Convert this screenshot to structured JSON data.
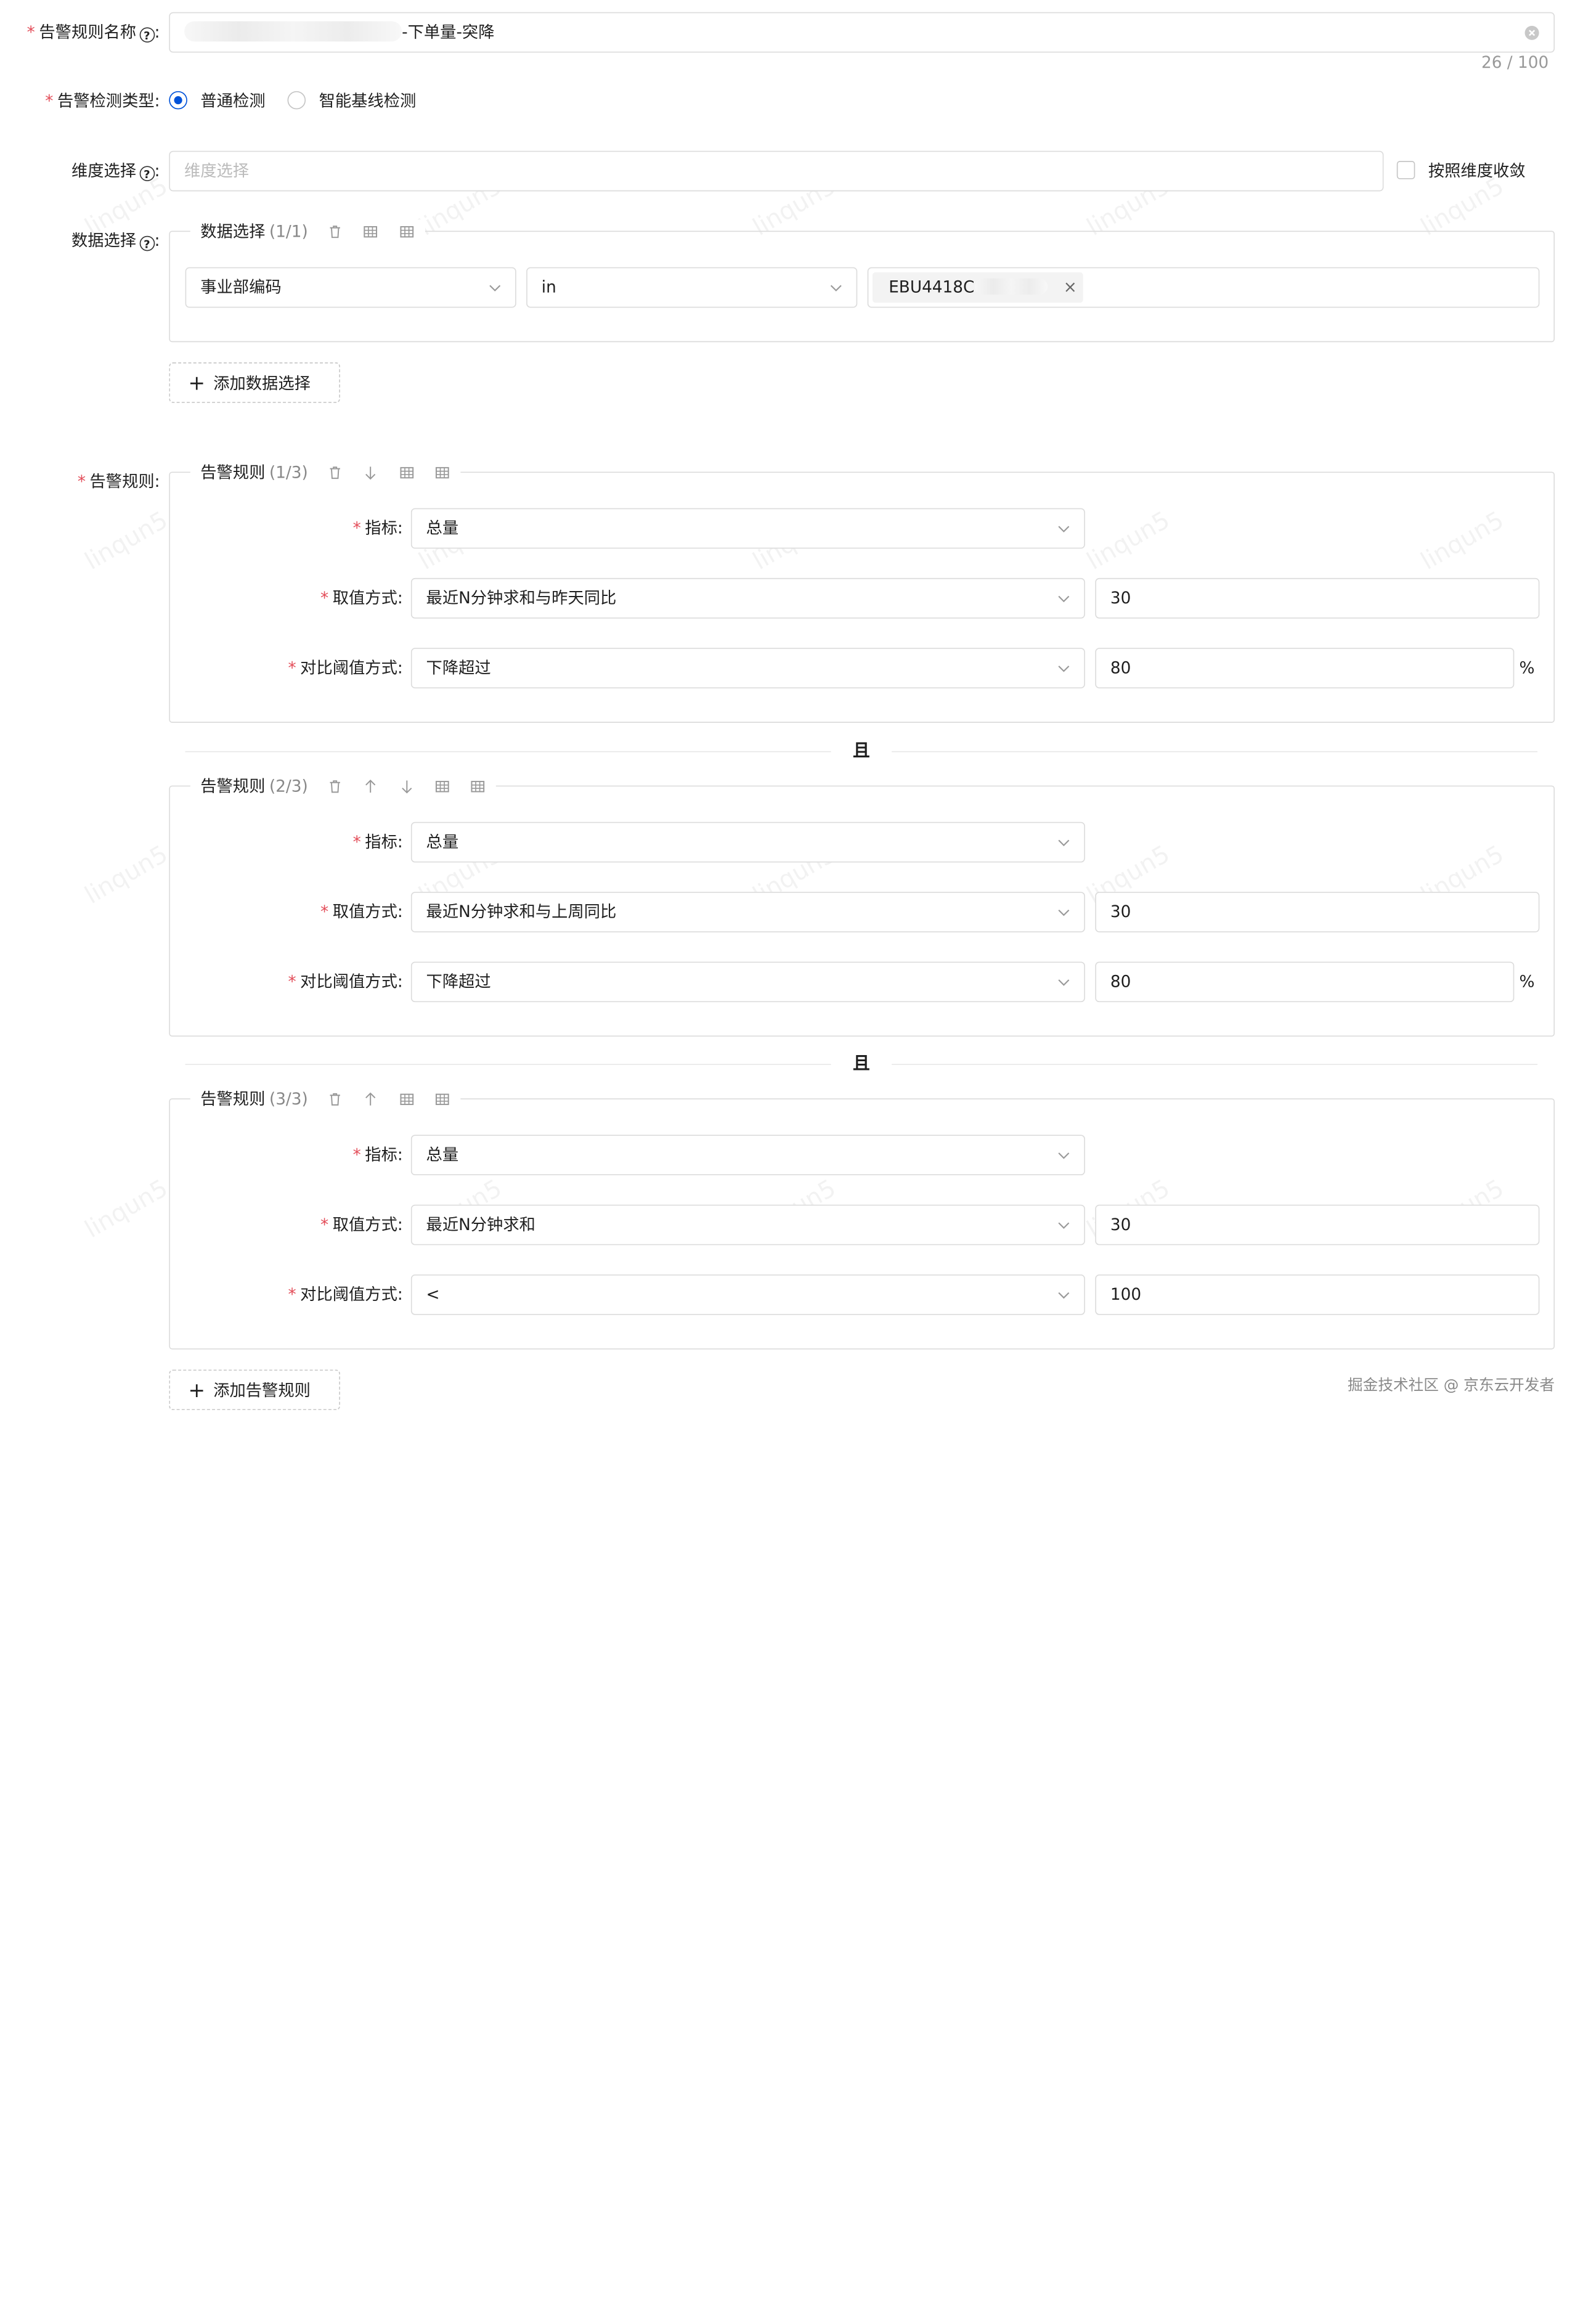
{
  "rule_name": {
    "label": "告警规则名称",
    "value_suffix": "-下单量-突降",
    "count": "26 / 100"
  },
  "detect_type": {
    "label": "告警检测类型",
    "options": [
      {
        "label": "普通检测",
        "selected": true
      },
      {
        "label": "智能基线检测",
        "selected": false
      }
    ]
  },
  "dimension": {
    "label": "维度选择",
    "placeholder": "维度选择",
    "converge_label": "按照维度收敛"
  },
  "data_select": {
    "label": "数据选择",
    "group_title": "数据选择",
    "group_count": "(1/1)",
    "field": "事业部编码",
    "operator": "in",
    "tag_value": "EBU4418C",
    "tag_close": "×",
    "add_label": "添加数据选择"
  },
  "alert_rules": {
    "label": "告警规则",
    "group_title": "告警规则",
    "field_labels": {
      "metric": "指标",
      "value_mode": "取值方式",
      "threshold_mode": "对比阈值方式"
    },
    "connector": "且",
    "percent": "%",
    "rules": [
      {
        "count": "(1/3)",
        "metric": "总量",
        "value_mode": "最近N分钟求和与昨天同比",
        "value_n": "30",
        "threshold_mode": "下降超过",
        "threshold_value": "80"
      },
      {
        "count": "(2/3)",
        "metric": "总量",
        "value_mode": "最近N分钟求和与上周同比",
        "value_n": "30",
        "threshold_mode": "下降超过",
        "threshold_value": "80"
      },
      {
        "count": "(3/3)",
        "metric": "总量",
        "value_mode": "最近N分钟求和",
        "value_n": "30",
        "threshold_mode": "<",
        "threshold_value": "100"
      }
    ],
    "add_label": "添加告警规则"
  },
  "footer": {
    "watermark_text": "掘金技术社区 @ 京东云开发者"
  },
  "colors": {
    "primary": "#0052d9",
    "required": "#e34d59",
    "border": "#dcdcdc"
  }
}
